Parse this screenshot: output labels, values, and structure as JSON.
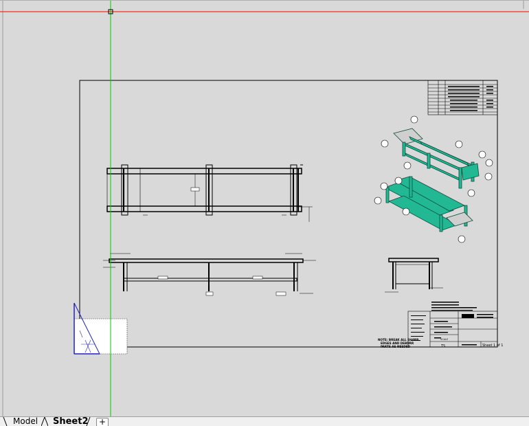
{
  "tabs": [
    {
      "label": "Model",
      "active": false
    },
    {
      "label": "Sheet2",
      "active": true
    }
  ],
  "add_tab_label": "+",
  "title_block": {
    "sheet_label": "Sheet 1 of 1",
    "rev": "TS",
    "scale_label": "SCALE"
  },
  "notes": [
    "NOTE: BREAK ALL SHARP",
    "EDGES AND DEBURR",
    "PARTS AS NEEDED"
  ],
  "colors": {
    "crosshair_vertical": "#00cc00",
    "crosshair_horizontal": "#ff0000",
    "frame_3d": "#1faa88",
    "viewport_selection": "#2020c0"
  }
}
